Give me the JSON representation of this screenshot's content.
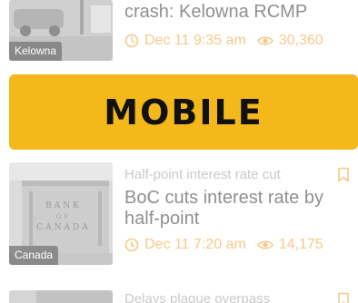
{
  "articles": [
    {
      "headline_fragment": "crash: Kelowna RCMP",
      "region": "Kelowna",
      "date": "Dec 11 9:35 am",
      "views": "30,360"
    },
    {
      "kicker": "Half-point interest rate cut",
      "headline": "BoC cuts interest rate by half-point",
      "region": "Canada",
      "date": "Dec 11 7:20 am",
      "views": "14,175"
    },
    {
      "kicker": "Delays plague overpass"
    }
  ],
  "promo": {
    "label": "MOBILE"
  },
  "colors": {
    "promo_background": "#f5b81a",
    "meta_accent": "#f6c98a",
    "headline_text": "#8f8f8f"
  },
  "icons": {
    "time": "clock-icon",
    "views": "eye-icon",
    "save": "bookmark-icon"
  }
}
